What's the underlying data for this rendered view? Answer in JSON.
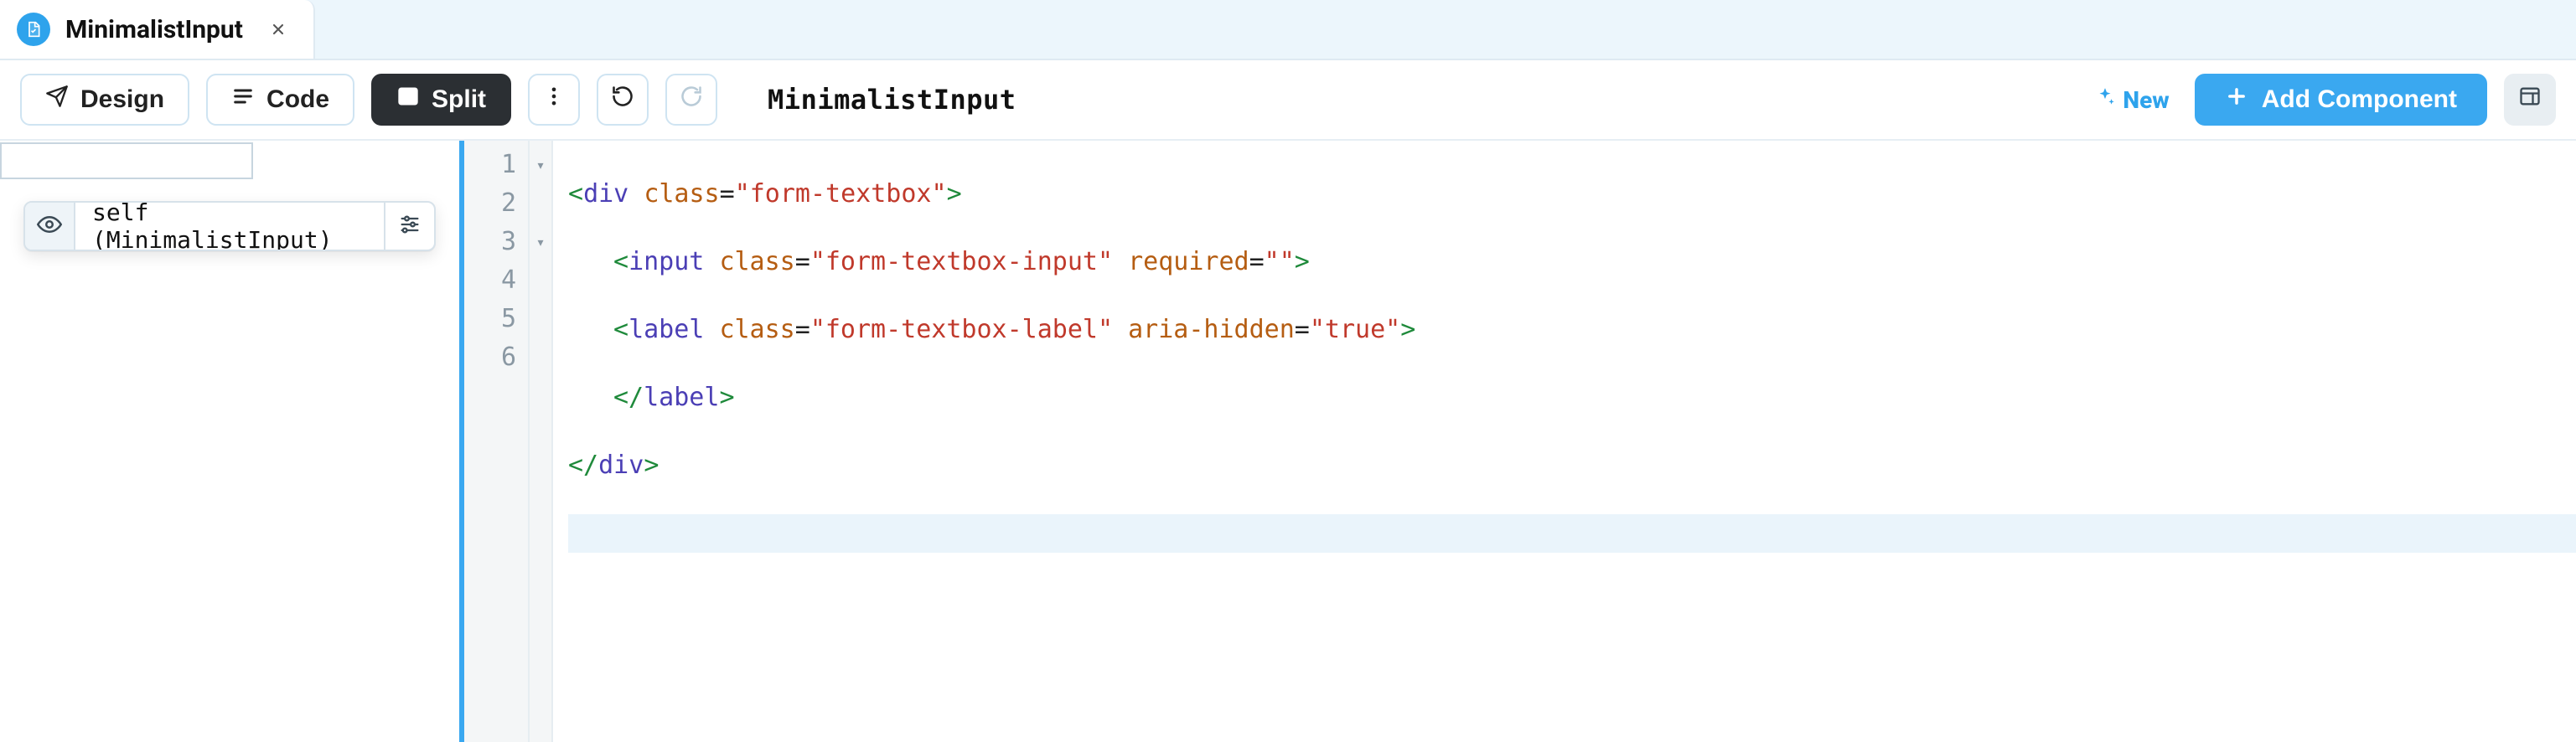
{
  "tab": {
    "title": "MinimalistInput"
  },
  "toolbar": {
    "design_label": "Design",
    "code_label": "Code",
    "split_label": "Split",
    "current_title": "MinimalistInput",
    "new_label": "New",
    "add_component_label": "Add Component"
  },
  "tree": {
    "search_value": "",
    "node_label": "self (MinimalistInput)"
  },
  "editor": {
    "lines": [
      {
        "n": "1",
        "foldable": true
      },
      {
        "n": "2",
        "foldable": false
      },
      {
        "n": "3",
        "foldable": true
      },
      {
        "n": "4",
        "foldable": false
      },
      {
        "n": "5",
        "foldable": false
      },
      {
        "n": "6",
        "foldable": false
      }
    ],
    "code": {
      "l1": {
        "tag_open": "div",
        "attr1_name": "class",
        "attr1_val": "\"form-textbox\""
      },
      "l2": {
        "tag_open": "input",
        "attr1_name": "class",
        "attr1_val": "\"form-textbox-input\"",
        "attr2_name": "required",
        "attr2_val": "\"\""
      },
      "l3": {
        "tag_open": "label",
        "attr1_name": "class",
        "attr1_val": "\"form-textbox-label\"",
        "attr2_name": "aria-hidden",
        "attr2_val": "\"true\""
      },
      "l4": {
        "tag_close": "label"
      },
      "l5": {
        "tag_close": "div"
      }
    }
  }
}
